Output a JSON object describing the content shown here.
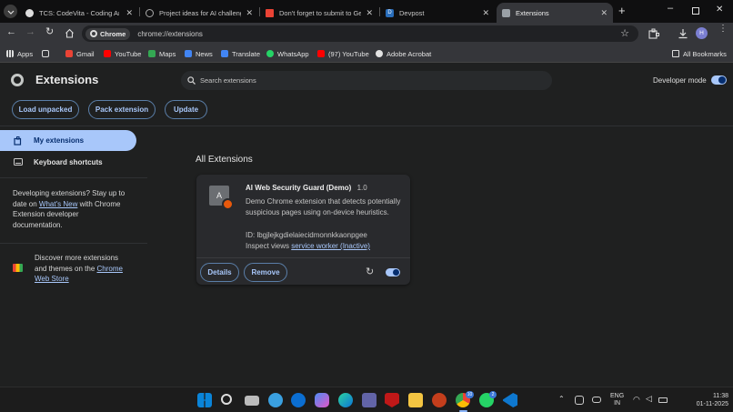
{
  "tabs": [
    {
      "label": "TCS: CodeVita - Coding Arena",
      "color": "#e7e7e7"
    },
    {
      "label": "Project ideas for AI challenge",
      "color": "#9aa0a6"
    },
    {
      "label": "Don't forget to submit to Gen",
      "color": "#ea4335"
    },
    {
      "label": "Devpost",
      "color": "#2a6ebb"
    },
    {
      "label": "Extensions",
      "color": "#9aa0a6"
    }
  ],
  "omnibox": {
    "chip": "Chrome",
    "url": "chrome://extensions"
  },
  "profile_initial": "H",
  "bookmarks": [
    {
      "label": "Apps",
      "color": "#8ab4f8"
    },
    {
      "label": "Gmail",
      "color": "#ea4335"
    },
    {
      "label": "YouTube",
      "color": "#ff0000"
    },
    {
      "label": "Maps",
      "color": "#34a853"
    },
    {
      "label": "News",
      "color": "#4285f4"
    },
    {
      "label": "Translate",
      "color": "#4285f4"
    },
    {
      "label": "WhatsApp",
      "color": "#25d366"
    },
    {
      "label": "(97) YouTube",
      "color": "#ff0000"
    },
    {
      "label": "Adobe Acrobat",
      "color": "#e3e3e3"
    }
  ],
  "all_bookmarks": "All Bookmarks",
  "header": {
    "title": "Extensions",
    "search_placeholder": "Search extensions",
    "dev_mode_label": "Developer mode"
  },
  "actions": {
    "load_unpacked": "Load unpacked",
    "pack_extension": "Pack extension",
    "update": "Update"
  },
  "sidebar": {
    "items": [
      {
        "label": "My extensions"
      },
      {
        "label": "Keyboard shortcuts"
      }
    ],
    "dev_note_pre": "Developing extensions? Stay up to date on ",
    "dev_note_link": "What's New",
    "dev_note_post": " with Chrome Extension developer documentation.",
    "discover_pre": "Discover more extensions and themes on the ",
    "discover_link": "Chrome Web Store"
  },
  "main": {
    "section_title": "All Extensions",
    "extension": {
      "icon_letter": "A",
      "name": "AI Web Security Guard (Demo)",
      "version": "1.0",
      "description": "Demo Chrome extension that detects potentially suspicious pages using on-device heuristics.",
      "id_label": "ID: lbgjlejkgdielaiecidmonnkkaonpgee",
      "inspect_label": "Inspect views ",
      "inspect_link": "service worker (Inactive)",
      "details_label": "Details",
      "remove_label": "Remove",
      "enabled": true
    }
  },
  "taskbar": {
    "lang1": "ENG",
    "lang2": "IN",
    "time": "11:38",
    "date": "01-11-2025",
    "chrome_badge": "10",
    "whatsapp_badge": "2"
  }
}
